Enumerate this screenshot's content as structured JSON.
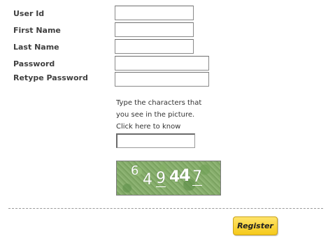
{
  "form": {
    "fields": [
      {
        "label": "User Id",
        "value": ""
      },
      {
        "label": "First Name",
        "value": ""
      },
      {
        "label": "Last Name",
        "value": ""
      },
      {
        "label": "Password",
        "value": ""
      },
      {
        "label": "Retype Password",
        "value": ""
      }
    ],
    "captcha": {
      "instruction_line1": "Type the characters that",
      "instruction_line2": "you see in the picture.",
      "help_link": "Click here to know",
      "input_value": "",
      "characters": [
        "6",
        "4",
        "9",
        "4",
        "4",
        "7"
      ]
    },
    "register_label": "Register"
  }
}
